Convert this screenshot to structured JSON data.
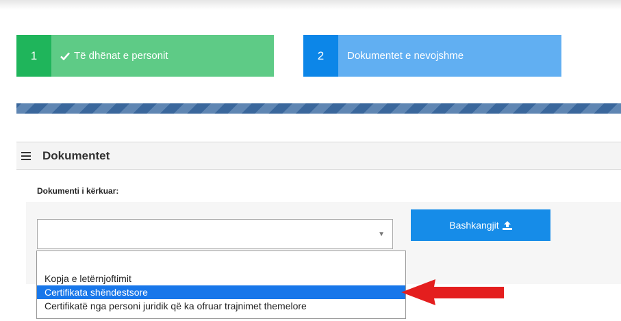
{
  "steps": [
    {
      "number": "1",
      "label": "Të dhënat e personit",
      "icon": "check-icon",
      "color": "#1fb55b"
    },
    {
      "number": "2",
      "label": "Dokumentet e nevojshme",
      "color": "#0c86e8"
    }
  ],
  "panel": {
    "title": "Dokumentet",
    "icon": "hamburger-icon",
    "field_label": "Dokumenti i kërkuar:",
    "select_value": "",
    "upload_button": "Bashkangjit",
    "upload_icon": "upload-icon",
    "options": [
      {
        "label": "",
        "selected": false
      },
      {
        "label": "Kopja e letërnjoftimit",
        "selected": false
      },
      {
        "label": "Certifikata shëndestsore",
        "selected": true
      },
      {
        "label": "Certifikatë nga personi juridik që ka ofruar trajnimet themelore",
        "selected": false
      }
    ]
  },
  "annotation": {
    "icon": "red-arrow-icon",
    "color": "#e41e1e"
  }
}
